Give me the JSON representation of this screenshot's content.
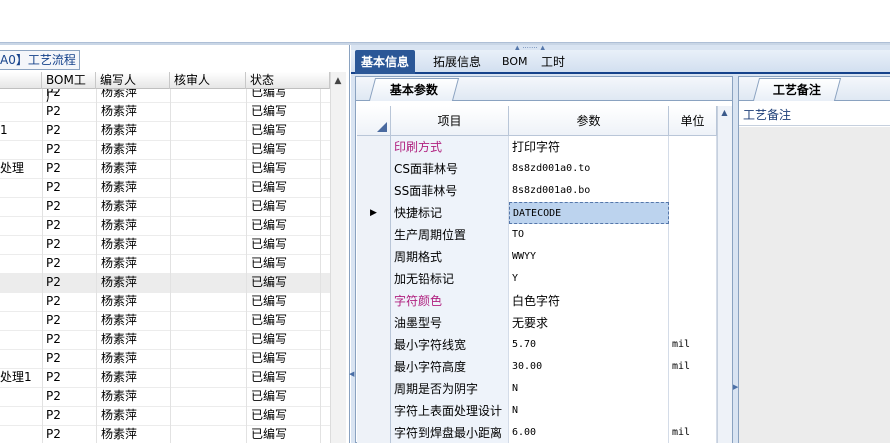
{
  "left": {
    "tab_label": "A0】工艺流程",
    "columns": [
      "BOM工厂",
      "编写人",
      "核审人",
      "状态"
    ],
    "rows": [
      {
        "name": "",
        "factory": "P2",
        "writer": "杨素萍",
        "reviewer": "",
        "status": "已编写"
      },
      {
        "name": "",
        "factory": "P2",
        "writer": "杨素萍",
        "reviewer": "",
        "status": "已编写"
      },
      {
        "name": "1",
        "factory": "P2",
        "writer": "杨素萍",
        "reviewer": "",
        "status": "已编写"
      },
      {
        "name": "",
        "factory": "P2",
        "writer": "杨素萍",
        "reviewer": "",
        "status": "已编写"
      },
      {
        "name": "处理",
        "factory": "P2",
        "writer": "杨素萍",
        "reviewer": "",
        "status": "已编写"
      },
      {
        "name": "",
        "factory": "P2",
        "writer": "杨素萍",
        "reviewer": "",
        "status": "已编写"
      },
      {
        "name": "",
        "factory": "P2",
        "writer": "杨素萍",
        "reviewer": "",
        "status": "已编写"
      },
      {
        "name": "",
        "factory": "P2",
        "writer": "杨素萍",
        "reviewer": "",
        "status": "已编写"
      },
      {
        "name": "",
        "factory": "P2",
        "writer": "杨素萍",
        "reviewer": "",
        "status": "已编写"
      },
      {
        "name": "",
        "factory": "P2",
        "writer": "杨素萍",
        "reviewer": "",
        "status": "已编写"
      },
      {
        "name": "",
        "factory": "P2",
        "writer": "杨素萍",
        "reviewer": "",
        "status": "已编写"
      },
      {
        "name": "",
        "factory": "P2",
        "writer": "杨素萍",
        "reviewer": "",
        "status": "已编写"
      },
      {
        "name": "",
        "factory": "P2",
        "writer": "杨素萍",
        "reviewer": "",
        "status": "已编写"
      },
      {
        "name": "",
        "factory": "P2",
        "writer": "杨素萍",
        "reviewer": "",
        "status": "已编写"
      },
      {
        "name": "",
        "factory": "P2",
        "writer": "杨素萍",
        "reviewer": "",
        "status": "已编写"
      },
      {
        "name": "处理1",
        "factory": "P2",
        "writer": "杨素萍",
        "reviewer": "",
        "status": "已编写"
      },
      {
        "name": "",
        "factory": "P2",
        "writer": "杨素萍",
        "reviewer": "",
        "status": "已编写"
      },
      {
        "name": "",
        "factory": "P2",
        "writer": "杨素萍",
        "reviewer": "",
        "status": "已编写"
      },
      {
        "name": "",
        "factory": "P2",
        "writer": "杨素萍",
        "reviewer": "",
        "status": "已编写"
      }
    ]
  },
  "tabs": [
    "基本信息",
    "拓展信息",
    "BOM",
    "工时"
  ],
  "params": {
    "tab_label": "基本参数",
    "columns": [
      "项目",
      "参数",
      "单位"
    ],
    "rows": [
      {
        "item": "印刷方式",
        "value": "打印字符",
        "unit": "",
        "pink": true
      },
      {
        "item": "CS面菲林号",
        "value": "8s8zd001a0.to",
        "unit": "",
        "pink": false
      },
      {
        "item": "SS面菲林号",
        "value": "8s8zd001a0.bo",
        "unit": "",
        "pink": false
      },
      {
        "item": "快捷标记",
        "value": "DATECODE",
        "unit": "",
        "pink": false
      },
      {
        "item": "生产周期位置",
        "value": "TO",
        "unit": "",
        "pink": false
      },
      {
        "item": "周期格式",
        "value": "WWYY",
        "unit": "",
        "pink": false
      },
      {
        "item": "加无铅标记",
        "value": "Y",
        "unit": "",
        "pink": false
      },
      {
        "item": "字符颜色",
        "value": "白色字符",
        "unit": "",
        "pink": true
      },
      {
        "item": "油墨型号",
        "value": "无要求",
        "unit": "",
        "pink": false
      },
      {
        "item": "最小字符线宽",
        "value": "5.70",
        "unit": "mil",
        "pink": false
      },
      {
        "item": "最小字符高度",
        "value": "30.00",
        "unit": "mil",
        "pink": false
      },
      {
        "item": "周期是否为阴字",
        "value": "N",
        "unit": "",
        "pink": false
      },
      {
        "item": "字符上表面处理设计",
        "value": "N",
        "unit": "",
        "pink": false
      },
      {
        "item": "字符到焊盘最小距离",
        "value": "6.00",
        "unit": "mil",
        "pink": false
      }
    ]
  },
  "notes": {
    "tab_label": "工艺备注",
    "label": "工艺备注"
  },
  "colors": {
    "accent": "#2b5797",
    "pink_label": "#b0207f",
    "selection": "#bcd3ee"
  }
}
